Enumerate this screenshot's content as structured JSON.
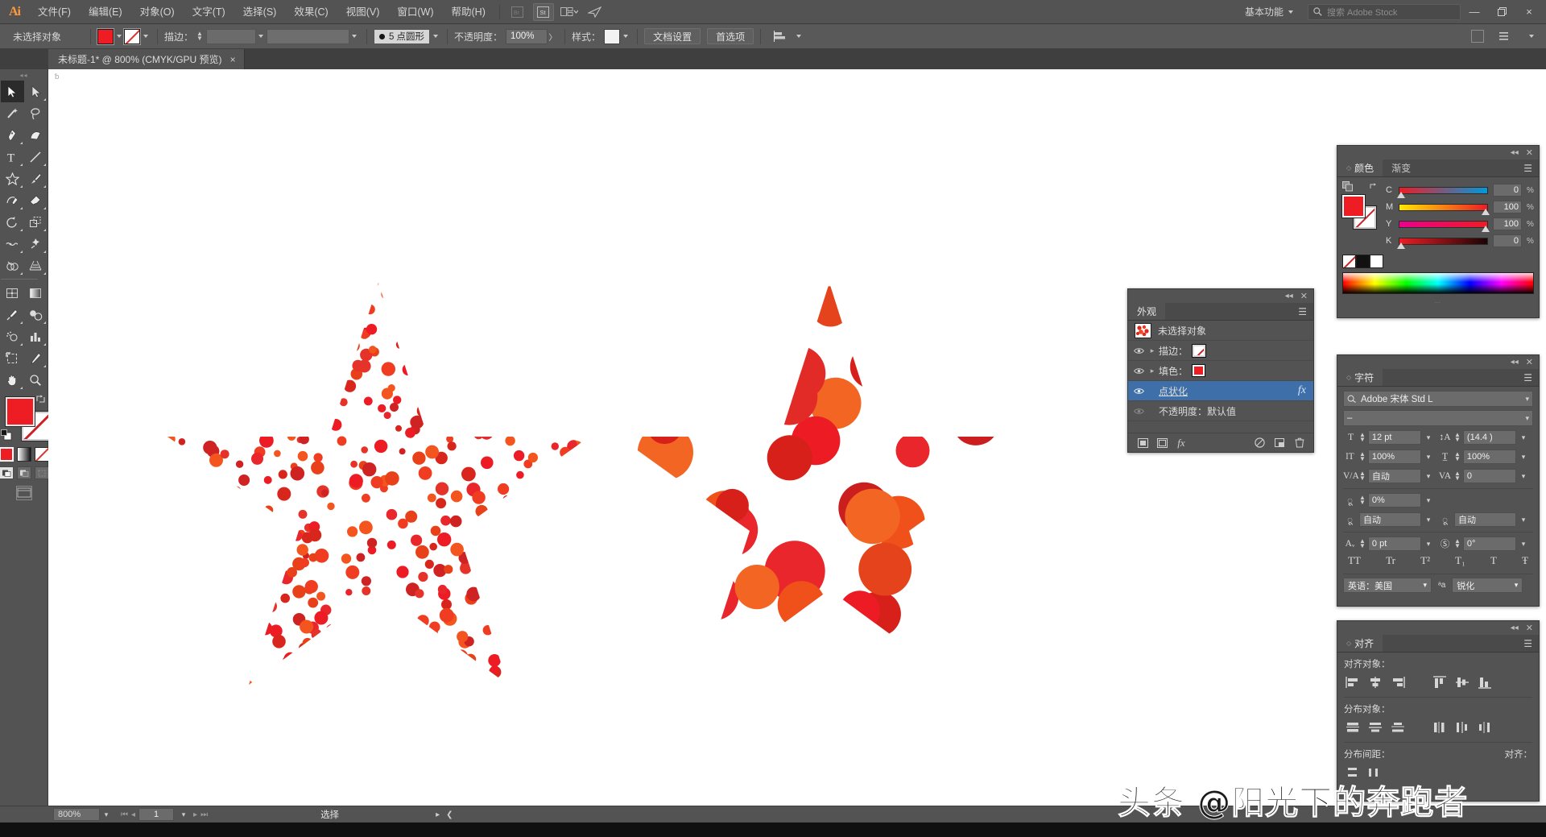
{
  "app": {
    "name": "Adobe Illustrator",
    "logo": "Ai"
  },
  "menubar": {
    "items": [
      {
        "label": "文件(F)",
        "name": "menu-file"
      },
      {
        "label": "编辑(E)",
        "name": "menu-edit"
      },
      {
        "label": "对象(O)",
        "name": "menu-object"
      },
      {
        "label": "文字(T)",
        "name": "menu-type"
      },
      {
        "label": "选择(S)",
        "name": "menu-select"
      },
      {
        "label": "效果(C)",
        "name": "menu-effect"
      },
      {
        "label": "视图(V)",
        "name": "menu-view"
      },
      {
        "label": "窗口(W)",
        "name": "menu-window"
      },
      {
        "label": "帮助(H)",
        "name": "menu-help"
      }
    ],
    "bridge_icon": "br-icon",
    "stock_icon": "st-icon",
    "arrange_icon": "arrange-documents-icon",
    "paperplane_icon": "share-icon",
    "workspace": "基本功能",
    "search_placeholder": "搜索 Adobe Stock",
    "window_buttons": {
      "minimize": "—",
      "restore": "❐",
      "close": "×"
    }
  },
  "controlbar": {
    "selection_label": "未选择对象",
    "fill_color": "#EE1C23",
    "stroke_color": "none",
    "stroke_label": "描边：",
    "stroke_weight": "",
    "stroke_profile": "",
    "brush_label": "5 点圆形",
    "opacity_label": "不透明度：",
    "opacity_value": "100%",
    "style_label": "样式：",
    "doc_setup_button": "文档设置",
    "preferences_button": "首选项",
    "align_icon": "align-icon"
  },
  "tabbar": {
    "document_tab": "未标题-1* @ 800% (CMYK/GPU 预览)",
    "close_glyph": "×"
  },
  "toolbar": {
    "tools": [
      {
        "name": "tool-selection",
        "label": "选择工具",
        "active": true
      },
      {
        "name": "tool-direct-selection",
        "label": "直接选择工具",
        "active": false
      },
      {
        "name": "tool-magic-wand",
        "label": "魔棒工具",
        "active": false
      },
      {
        "name": "tool-lasso",
        "label": "套索工具",
        "active": false
      },
      {
        "name": "tool-pen",
        "label": "钢笔工具",
        "active": false
      },
      {
        "name": "tool-curvature",
        "label": "曲率工具",
        "active": false
      },
      {
        "name": "tool-type",
        "label": "文字工具",
        "active": false
      },
      {
        "name": "tool-line-segment",
        "label": "直线段工具",
        "active": false
      },
      {
        "name": "tool-shape-star",
        "label": "星形工具",
        "active": false
      },
      {
        "name": "tool-paintbrush",
        "label": "画笔工具",
        "active": false
      },
      {
        "name": "tool-shaper",
        "label": "Shaper 工具",
        "active": false
      },
      {
        "name": "tool-eraser",
        "label": "橡皮擦工具",
        "active": false
      },
      {
        "name": "tool-rotate",
        "label": "旋转工具",
        "active": false
      },
      {
        "name": "tool-scale",
        "label": "比例缩放工具",
        "active": false
      },
      {
        "name": "tool-width",
        "label": "宽度工具",
        "active": false
      },
      {
        "name": "tool-free-transform",
        "label": "自由变换工具",
        "active": false
      },
      {
        "name": "tool-shape-builder",
        "label": "形状生成器工具",
        "active": false
      },
      {
        "name": "tool-perspective-grid",
        "label": "透视网格工具",
        "active": false
      },
      {
        "name": "tool-mesh",
        "label": "网格工具",
        "active": false
      },
      {
        "name": "tool-gradient",
        "label": "渐变工具",
        "active": false
      },
      {
        "name": "tool-eyedropper",
        "label": "吸管工具",
        "active": false
      },
      {
        "name": "tool-blend",
        "label": "混合工具",
        "active": false
      },
      {
        "name": "tool-symbol-sprayer",
        "label": "符号喷枪工具",
        "active": false
      },
      {
        "name": "tool-column-graph",
        "label": "柱形图工具",
        "active": false
      },
      {
        "name": "tool-artboard",
        "label": "画板工具",
        "active": false
      },
      {
        "name": "tool-slice",
        "label": "切片工具",
        "active": false
      },
      {
        "name": "tool-hand",
        "label": "抓手工具",
        "active": false
      },
      {
        "name": "tool-zoom",
        "label": "缩放工具",
        "active": false
      }
    ],
    "fill_color": "#EE1C23",
    "stroke_color": "none",
    "modes": [
      "color-mode",
      "gradient-mode",
      "none-mode"
    ],
    "draw_modes": [
      "draw-normal",
      "draw-behind",
      "draw-inside"
    ]
  },
  "appearance_panel": {
    "tab": "外观",
    "rows": [
      {
        "name": "appearance-target-row",
        "label": "未选择对象",
        "type": "thumb"
      },
      {
        "name": "appearance-stroke-row",
        "label": "描边：",
        "type": "stroke"
      },
      {
        "name": "appearance-fill-row",
        "label": "填色：",
        "type": "fill"
      },
      {
        "name": "appearance-effect-row",
        "label": "点状化",
        "type": "effect",
        "selected": true,
        "fx": "fx"
      },
      {
        "name": "appearance-opacity-row",
        "label": "不透明度：默认值",
        "type": "opacity"
      }
    ],
    "footer_icons": [
      "add-new-stroke-icon",
      "add-new-fill-icon",
      "add-new-effect-icon",
      "clear-appearance-icon",
      "duplicate-item-icon",
      "delete-item-icon"
    ]
  },
  "color_panel": {
    "tabs": [
      {
        "label": "颜色",
        "active": true
      },
      {
        "label": "渐变",
        "active": false
      }
    ],
    "channels": [
      {
        "name": "cyan",
        "letter": "C",
        "value": "0",
        "unit": "%",
        "pos": 0
      },
      {
        "name": "magenta",
        "letter": "M",
        "value": "100",
        "unit": "%",
        "pos": 100
      },
      {
        "name": "yellow",
        "letter": "Y",
        "value": "100",
        "unit": "%",
        "pos": 100
      },
      {
        "name": "black",
        "letter": "K",
        "value": "0",
        "unit": "%",
        "pos": 0
      }
    ],
    "fill_color": "#EE1C23",
    "quick_swatches": [
      "none",
      "black",
      "white"
    ]
  },
  "character_panel": {
    "tab": "字符",
    "font_family": "Adobe 宋体 Std L",
    "font_style": "–",
    "font_size": "12 pt",
    "leading": "(14.4 )",
    "vertical_scale": "100%",
    "horizontal_scale": "100%",
    "kerning": "自动",
    "tracking": "0",
    "tsume": "0%",
    "vertical_offset_left": "自动",
    "vertical_offset_right": "自动",
    "baseline_shift": "0 pt",
    "character_rotation": "0°",
    "style_buttons": [
      "TT",
      "Tr",
      "T²",
      "T₁",
      "T",
      "Ŧ"
    ],
    "language": "英语：美国",
    "anti_alias": "锐化"
  },
  "align_panel": {
    "tab": "对齐",
    "align_objects_label": "对齐对象：",
    "distribute_objects_label": "分布对象：",
    "distribute_spacing_label": "分布间距：",
    "align_to_label": "对齐：",
    "align_buttons": [
      "align-left",
      "align-horizontal-center",
      "align-right",
      "align-top",
      "align-vertical-center",
      "align-bottom"
    ],
    "distribute_buttons": [
      "dist-top",
      "dist-vertical-center",
      "dist-bottom",
      "dist-left",
      "dist-horizontal-center",
      "dist-right"
    ]
  },
  "statusbar": {
    "zoom": "800%",
    "page": "1",
    "tool_status": "选择"
  },
  "canvas": {
    "star_left": {
      "name": "star-pointillize-small",
      "description": "红色五角星 - 细点状化效果",
      "dot_count": 520,
      "dot_radius_min": 4,
      "dot_radius_max": 9,
      "colors": [
        "#ed1c24",
        "#e8262b",
        "#f03c20",
        "#e8411a",
        "#d9261c",
        "#f4551e",
        "#e5332a",
        "#cf2222"
      ]
    },
    "star_right": {
      "name": "star-pointillize-large",
      "description": "红色五角星 - 粗点状化效果",
      "dot_count": 58,
      "dot_radius_min": 20,
      "dot_radius_max": 38,
      "colors": [
        "#ed1c24",
        "#e8262b",
        "#f0501a",
        "#e5431c",
        "#d8201b",
        "#f26522",
        "#e22a26",
        "#cb1f1f"
      ]
    }
  },
  "watermark": {
    "text": "头条 @阳光下的奔跑者"
  }
}
